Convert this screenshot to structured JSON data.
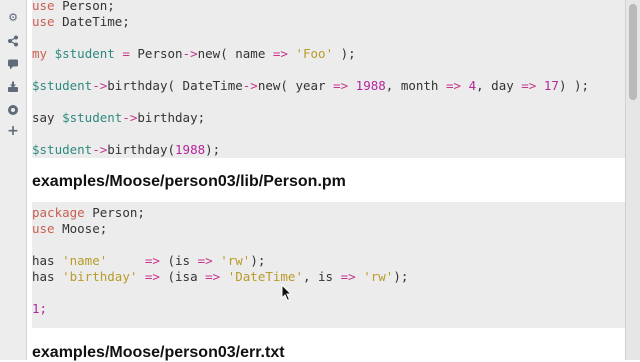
{
  "colors": {
    "keyword": "#c85f52",
    "variable": "#2e8a7f",
    "operator": "#c5338c",
    "string": "#b89c2a",
    "number": "#b3279b",
    "plain": "#333333",
    "code_background": "#ececec"
  },
  "sidebar": {
    "icons": [
      "gear-icon",
      "share-icon",
      "chat-icon",
      "download-icon",
      "record-icon",
      "plus-icon"
    ]
  },
  "code_block_1": {
    "lines": [
      [
        {
          "t": "use",
          "c": "kw"
        },
        {
          "t": " Person;",
          "c": "pl"
        }
      ],
      [
        {
          "t": "use",
          "c": "kw"
        },
        {
          "t": " DateTime;",
          "c": "pl"
        }
      ],
      [],
      [
        {
          "t": "my",
          "c": "kw"
        },
        {
          "t": " ",
          "c": "pl"
        },
        {
          "t": "$student",
          "c": "var"
        },
        {
          "t": " ",
          "c": "pl"
        },
        {
          "t": "=",
          "c": "op"
        },
        {
          "t": " Person",
          "c": "pl"
        },
        {
          "t": "->",
          "c": "op"
        },
        {
          "t": "new(",
          "c": "pl"
        },
        {
          "t": " name ",
          "c": "pl"
        },
        {
          "t": "=>",
          "c": "op"
        },
        {
          "t": " ",
          "c": "pl"
        },
        {
          "t": "'Foo'",
          "c": "str"
        },
        {
          "t": " );",
          "c": "pl"
        }
      ],
      [],
      [
        {
          "t": "$student",
          "c": "var"
        },
        {
          "t": "->",
          "c": "op"
        },
        {
          "t": "birthday(",
          "c": "pl"
        },
        {
          "t": " DateTime",
          "c": "pl"
        },
        {
          "t": "->",
          "c": "op"
        },
        {
          "t": "new(",
          "c": "pl"
        },
        {
          "t": " year ",
          "c": "pl"
        },
        {
          "t": "=>",
          "c": "op"
        },
        {
          "t": " ",
          "c": "pl"
        },
        {
          "t": "1988",
          "c": "num"
        },
        {
          "t": ", month ",
          "c": "pl"
        },
        {
          "t": "=>",
          "c": "op"
        },
        {
          "t": " ",
          "c": "pl"
        },
        {
          "t": "4",
          "c": "num"
        },
        {
          "t": ", day ",
          "c": "pl"
        },
        {
          "t": "=>",
          "c": "op"
        },
        {
          "t": " ",
          "c": "pl"
        },
        {
          "t": "17",
          "c": "num"
        },
        {
          "t": ") );",
          "c": "pl"
        }
      ],
      [],
      [
        {
          "t": "say ",
          "c": "pl"
        },
        {
          "t": "$student",
          "c": "var"
        },
        {
          "t": "->",
          "c": "op"
        },
        {
          "t": "birthday;",
          "c": "pl"
        }
      ],
      [],
      [
        {
          "t": "$student",
          "c": "var"
        },
        {
          "t": "->",
          "c": "op"
        },
        {
          "t": "birthday(",
          "c": "pl"
        },
        {
          "t": "1988",
          "c": "num"
        },
        {
          "t": ");",
          "c": "pl"
        }
      ]
    ]
  },
  "heading_1": "examples/Moose/person03/lib/Person.pm",
  "code_block_2": {
    "lines": [
      [
        {
          "t": "package",
          "c": "kw"
        },
        {
          "t": " Person;",
          "c": "pl"
        }
      ],
      [
        {
          "t": "use",
          "c": "kw"
        },
        {
          "t": " Moose;",
          "c": "pl"
        }
      ],
      [],
      [
        {
          "t": "has ",
          "c": "pl"
        },
        {
          "t": "'name'",
          "c": "str"
        },
        {
          "t": "     ",
          "c": "pl"
        },
        {
          "t": "=>",
          "c": "op"
        },
        {
          "t": " (is ",
          "c": "pl"
        },
        {
          "t": "=>",
          "c": "op"
        },
        {
          "t": " ",
          "c": "pl"
        },
        {
          "t": "'rw'",
          "c": "str"
        },
        {
          "t": ");",
          "c": "pl"
        }
      ],
      [
        {
          "t": "has ",
          "c": "pl"
        },
        {
          "t": "'birthday'",
          "c": "str"
        },
        {
          "t": " ",
          "c": "pl"
        },
        {
          "t": "=>",
          "c": "op"
        },
        {
          "t": " (isa ",
          "c": "pl"
        },
        {
          "t": "=>",
          "c": "op"
        },
        {
          "t": " ",
          "c": "pl"
        },
        {
          "t": "'DateTime'",
          "c": "str"
        },
        {
          "t": ", is ",
          "c": "pl"
        },
        {
          "t": "=>",
          "c": "op"
        },
        {
          "t": " ",
          "c": "pl"
        },
        {
          "t": "'rw'",
          "c": "str"
        },
        {
          "t": ");",
          "c": "pl"
        }
      ],
      [],
      [
        {
          "t": "1;",
          "c": "num"
        }
      ]
    ]
  },
  "heading_2": "examples/Moose/person03/err.txt"
}
